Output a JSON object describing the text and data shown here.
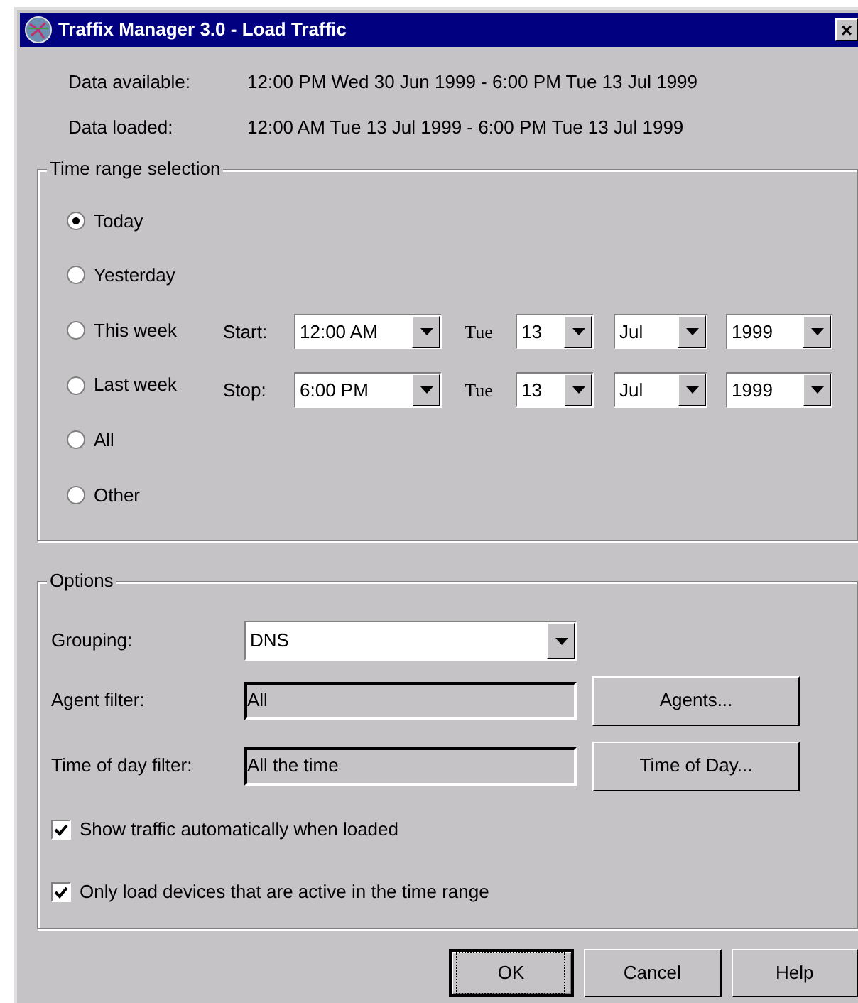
{
  "window": {
    "title": "Traffix Manager 3.0 - Load Traffic",
    "close": "×"
  },
  "info": [
    {
      "label": "Data available:",
      "value": "12:00 PM Wed 30 Jun 1999 - 6:00 PM Tue 13 Jul 1999"
    },
    {
      "label": "Data loaded:",
      "value": "12:00 AM Tue 13 Jul 1999 - 6:00 PM Tue 13 Jul 1999"
    }
  ],
  "time_range": {
    "title": "Time range selection",
    "options": [
      {
        "label": "Today",
        "selected": true
      },
      {
        "label": "Yesterday",
        "selected": false
      },
      {
        "label": "This week",
        "selected": false
      },
      {
        "label": "Last week",
        "selected": false
      },
      {
        "label": "All",
        "selected": false
      },
      {
        "label": "Other",
        "selected": false
      }
    ],
    "ranges": [
      {
        "label": "Start:",
        "time": "12:00 AM",
        "weekday": "Tue",
        "day": "13",
        "month": "Jul",
        "year": "1999"
      },
      {
        "label": "Stop:",
        "time": "6:00 PM",
        "weekday": "Tue",
        "day": "13",
        "month": "Jul",
        "year": "1999"
      }
    ]
  },
  "options": {
    "title": "Options",
    "grouping": {
      "label": "Grouping:",
      "value": "DNS"
    },
    "filters": [
      {
        "label": "Agent filter:",
        "value": "All",
        "button": "Agents..."
      },
      {
        "label": "Time of day filter:",
        "value": "All the time",
        "button": "Time of Day..."
      }
    ],
    "checkboxes": [
      {
        "label": "Show traffic automatically when loaded",
        "checked": true
      },
      {
        "label": "Only load devices that are active in the time range",
        "checked": true
      }
    ]
  },
  "buttons": [
    {
      "label": "OK",
      "focused": true
    },
    {
      "label": "Cancel",
      "focused": false
    },
    {
      "label": "Help",
      "focused": false
    }
  ]
}
